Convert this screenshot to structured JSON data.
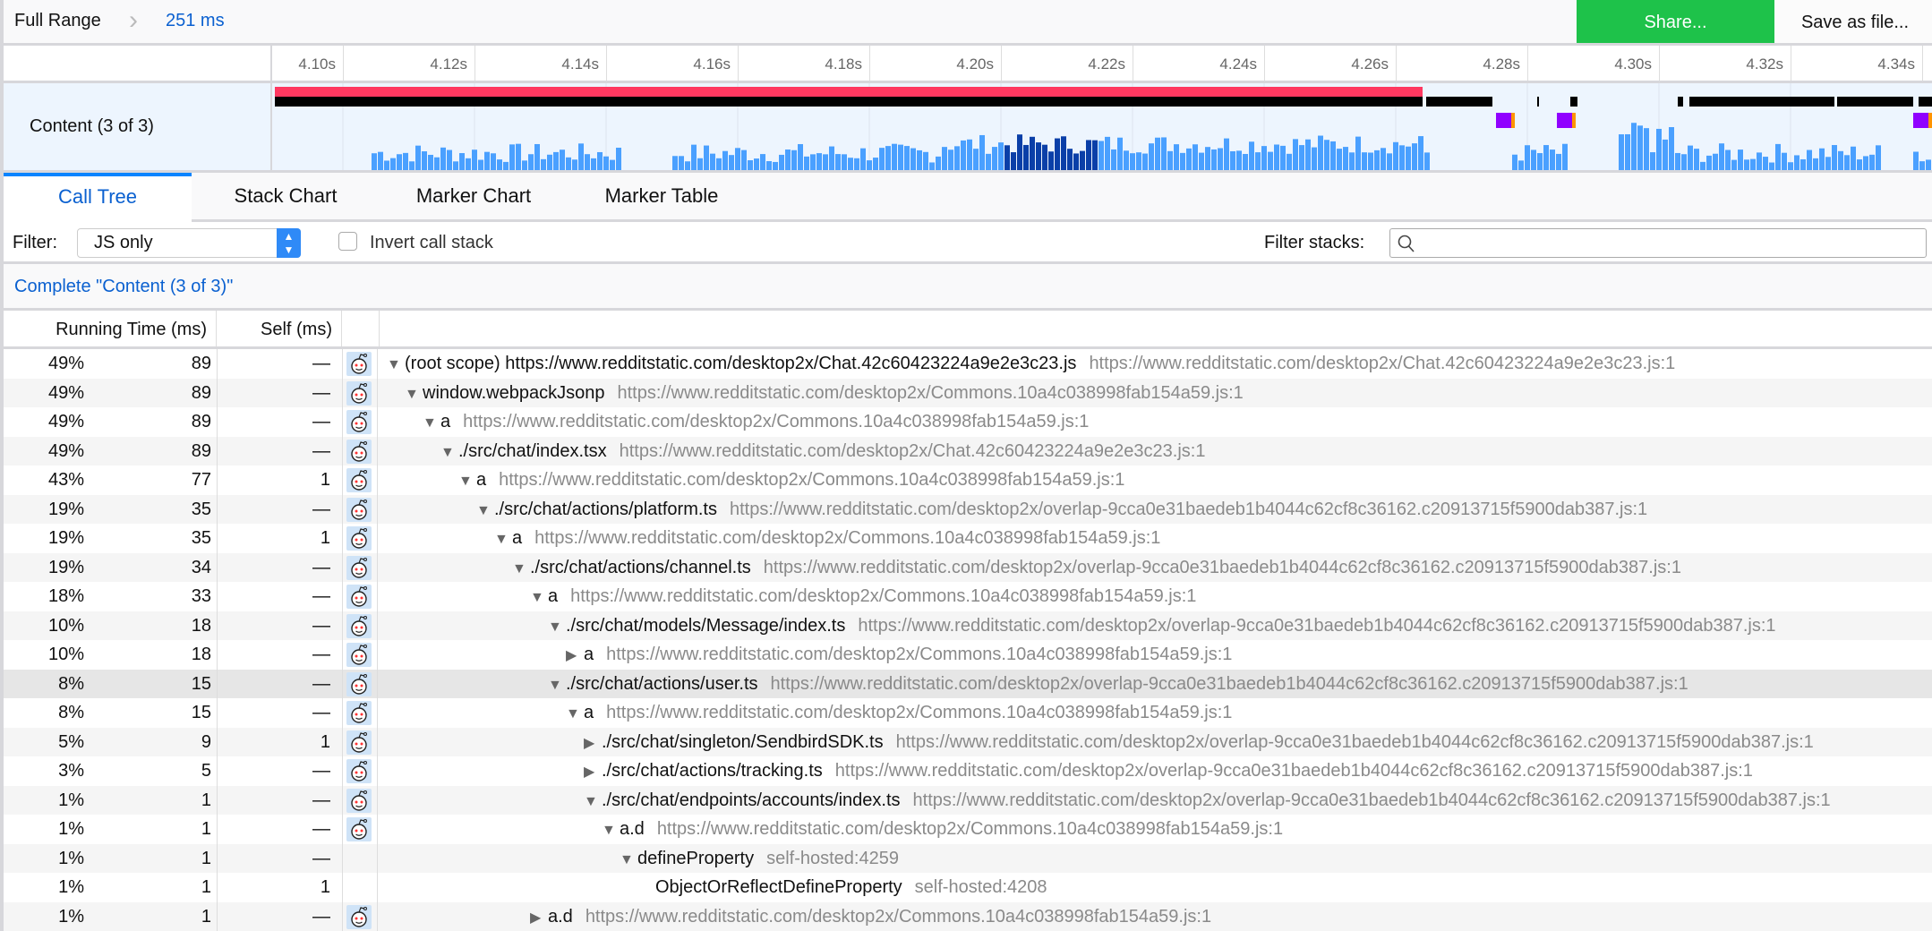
{
  "topbar": {
    "breadcrumb_root": "Full Range",
    "breadcrumb_range": "251 ms",
    "share_label": "Share...",
    "save_label": "Save as file..."
  },
  "colors": {
    "share": "#1ec24a",
    "accent": "#0a84ff",
    "cpu_graph": "#4aa0ff",
    "cpu_graph_selected": "#0a3fa8",
    "jank_marker": "#ff3860"
  },
  "timeline": {
    "ticks": [
      "4.10s",
      "4.12s",
      "4.14s",
      "4.16s",
      "4.18s",
      "4.20s",
      "4.22s",
      "4.24s",
      "4.26s",
      "4.28s",
      "4.30s",
      "4.32s",
      "4.34s"
    ],
    "track_label": "Content (3 of 3)"
  },
  "tabs": [
    {
      "label": "Call Tree",
      "selected": true
    },
    {
      "label": "Stack Chart"
    },
    {
      "label": "Marker Chart"
    },
    {
      "label": "Marker Table"
    }
  ],
  "filter": {
    "label": "Filter:",
    "value": "JS only",
    "invert_label": "Invert call stack",
    "invert_checked": false,
    "search_label": "Filter stacks:",
    "search_value": ""
  },
  "breadcrumb": "Complete \"Content (3 of 3)\"",
  "columns": {
    "running": "Running Time (ms)",
    "self": "Self (ms)"
  },
  "rows": [
    {
      "pct": "49%",
      "total": "89",
      "self": "—",
      "depth": 0,
      "twisty": "open",
      "icon": true,
      "name": "(root scope) https://www.redditstatic.com/desktop2x/Chat.42c60423224a9e2e3c23.js",
      "src": "https://www.redditstatic.com/desktop2x/Chat.42c60423224a9e2e3c23.js:1"
    },
    {
      "pct": "49%",
      "total": "89",
      "self": "—",
      "depth": 1,
      "twisty": "open",
      "icon": true,
      "name": "window.webpackJsonp",
      "src": "https://www.redditstatic.com/desktop2x/Commons.10a4c038998fab154a59.js:1"
    },
    {
      "pct": "49%",
      "total": "89",
      "self": "—",
      "depth": 2,
      "twisty": "open",
      "icon": true,
      "name": "a",
      "src": "https://www.redditstatic.com/desktop2x/Commons.10a4c038998fab154a59.js:1"
    },
    {
      "pct": "49%",
      "total": "89",
      "self": "—",
      "depth": 3,
      "twisty": "open",
      "icon": true,
      "name": "./src/chat/index.tsx",
      "src": "https://www.redditstatic.com/desktop2x/Chat.42c60423224a9e2e3c23.js:1"
    },
    {
      "pct": "43%",
      "total": "77",
      "self": "1",
      "depth": 4,
      "twisty": "open",
      "icon": true,
      "name": "a",
      "src": "https://www.redditstatic.com/desktop2x/Commons.10a4c038998fab154a59.js:1"
    },
    {
      "pct": "19%",
      "total": "35",
      "self": "—",
      "depth": 5,
      "twisty": "open",
      "icon": true,
      "name": "./src/chat/actions/platform.ts",
      "src": "https://www.redditstatic.com/desktop2x/overlap-9cca0e31baedeb1b4044c62cf8c36162.c20913715f5900dab387.js:1"
    },
    {
      "pct": "19%",
      "total": "35",
      "self": "1",
      "depth": 6,
      "twisty": "open",
      "icon": true,
      "name": "a",
      "src": "https://www.redditstatic.com/desktop2x/Commons.10a4c038998fab154a59.js:1"
    },
    {
      "pct": "19%",
      "total": "34",
      "self": "—",
      "depth": 7,
      "twisty": "open",
      "icon": true,
      "name": "./src/chat/actions/channel.ts",
      "src": "https://www.redditstatic.com/desktop2x/overlap-9cca0e31baedeb1b4044c62cf8c36162.c20913715f5900dab387.js:1"
    },
    {
      "pct": "18%",
      "total": "33",
      "self": "—",
      "depth": 8,
      "twisty": "open",
      "icon": true,
      "name": "a",
      "src": "https://www.redditstatic.com/desktop2x/Commons.10a4c038998fab154a59.js:1"
    },
    {
      "pct": "10%",
      "total": "18",
      "self": "—",
      "depth": 9,
      "twisty": "open",
      "icon": true,
      "name": "./src/chat/models/Message/index.ts",
      "src": "https://www.redditstatic.com/desktop2x/overlap-9cca0e31baedeb1b4044c62cf8c36162.c20913715f5900dab387.js:1"
    },
    {
      "pct": "10%",
      "total": "18",
      "self": "—",
      "depth": 10,
      "twisty": "closed",
      "icon": true,
      "name": "a",
      "src": "https://www.redditstatic.com/desktop2x/Commons.10a4c038998fab154a59.js:1"
    },
    {
      "pct": "8%",
      "total": "15",
      "self": "—",
      "depth": 9,
      "twisty": "open",
      "icon": true,
      "selected": true,
      "name": "./src/chat/actions/user.ts",
      "src": "https://www.redditstatic.com/desktop2x/overlap-9cca0e31baedeb1b4044c62cf8c36162.c20913715f5900dab387.js:1"
    },
    {
      "pct": "8%",
      "total": "15",
      "self": "—",
      "depth": 10,
      "twisty": "open",
      "icon": true,
      "name": "a",
      "src": "https://www.redditstatic.com/desktop2x/Commons.10a4c038998fab154a59.js:1"
    },
    {
      "pct": "5%",
      "total": "9",
      "self": "1",
      "depth": 11,
      "twisty": "closed",
      "icon": true,
      "name": "./src/chat/singleton/SendbirdSDK.ts",
      "src": "https://www.redditstatic.com/desktop2x/overlap-9cca0e31baedeb1b4044c62cf8c36162.c20913715f5900dab387.js:1"
    },
    {
      "pct": "3%",
      "total": "5",
      "self": "—",
      "depth": 11,
      "twisty": "closed",
      "icon": true,
      "name": "./src/chat/actions/tracking.ts",
      "src": "https://www.redditstatic.com/desktop2x/overlap-9cca0e31baedeb1b4044c62cf8c36162.c20913715f5900dab387.js:1"
    },
    {
      "pct": "1%",
      "total": "1",
      "self": "—",
      "depth": 11,
      "twisty": "open",
      "icon": true,
      "name": "./src/chat/endpoints/accounts/index.ts",
      "src": "https://www.redditstatic.com/desktop2x/overlap-9cca0e31baedeb1b4044c62cf8c36162.c20913715f5900dab387.js:1"
    },
    {
      "pct": "1%",
      "total": "1",
      "self": "—",
      "depth": 12,
      "twisty": "open",
      "icon": true,
      "name": "a.d",
      "src": "https://www.redditstatic.com/desktop2x/Commons.10a4c038998fab154a59.js:1"
    },
    {
      "pct": "1%",
      "total": "1",
      "self": "—",
      "depth": 13,
      "twisty": "open",
      "icon": false,
      "name": "defineProperty",
      "src": "self-hosted:4259"
    },
    {
      "pct": "1%",
      "total": "1",
      "self": "1",
      "depth": 14,
      "twisty": "none",
      "icon": false,
      "name": "ObjectOrReflectDefineProperty",
      "src": "self-hosted:4208"
    },
    {
      "pct": "1%",
      "total": "1",
      "self": "—",
      "depth": 8,
      "twisty": "closed",
      "icon": true,
      "name": "a.d",
      "src": "https://www.redditstatic.com/desktop2x/Commons.10a4c038998fab154a59.js:1"
    }
  ]
}
